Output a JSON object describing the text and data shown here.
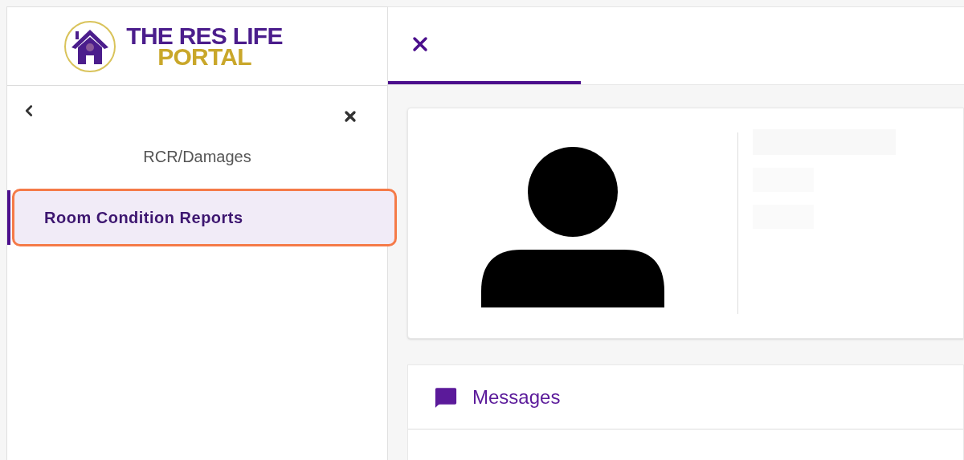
{
  "logo": {
    "line_1": "THE RES LIFE",
    "line_2": "PORTAL"
  },
  "nav": {
    "items": [
      {
        "label": "RCR/Damages",
        "selected": false,
        "highlighted": false
      },
      {
        "label": "Room Condition Reports",
        "selected": true,
        "highlighted": true
      }
    ]
  },
  "tabs": [
    {
      "selected": true
    }
  ],
  "messages": {
    "title": "Messages"
  }
}
